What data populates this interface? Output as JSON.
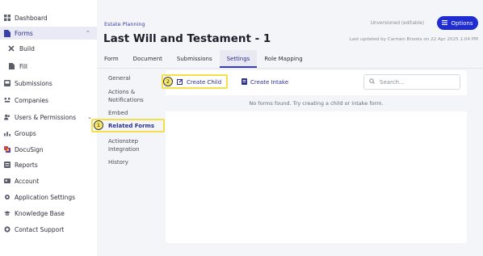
{
  "sidebar": {
    "items": [
      {
        "label": "Dashboard",
        "icon": "grid-icon"
      },
      {
        "label": "Forms",
        "icon": "document-icon",
        "expanded": true
      },
      {
        "label": "Build",
        "icon": "tools-icon"
      },
      {
        "label": "Fill",
        "icon": "file-icon"
      },
      {
        "label": "Submissions",
        "icon": "inbox-icon"
      },
      {
        "label": "Companies",
        "icon": "building-icon"
      },
      {
        "label": "Users & Permissions",
        "icon": "users-icon"
      },
      {
        "label": "Groups",
        "icon": "groups-icon"
      },
      {
        "label": "DocuSign",
        "icon": "docusign-icon"
      },
      {
        "label": "Reports",
        "icon": "report-icon"
      },
      {
        "label": "Account",
        "icon": "account-icon"
      },
      {
        "label": "Application Settings",
        "icon": "gear-icon"
      },
      {
        "label": "Knowledge Base",
        "icon": "graduation-cap-icon"
      },
      {
        "label": "Contact Support",
        "icon": "support-icon"
      }
    ]
  },
  "header": {
    "breadcrumb": "Estate Planning",
    "title": "Last Will and Testament - 1",
    "version": "Unversioned (editable)",
    "options_label": "Options",
    "updated": "Last updated by Carmen Brooks on 22 Apr 2025 1:04 PM"
  },
  "tabs": [
    {
      "label": "Form"
    },
    {
      "label": "Document"
    },
    {
      "label": "Submissions"
    },
    {
      "label": "Settings",
      "active": true
    },
    {
      "label": "Role Mapping"
    }
  ],
  "settings_nav": [
    {
      "label": "General"
    },
    {
      "label": "Actions & Notifications"
    },
    {
      "label": "Embed"
    },
    {
      "label": "Related Forms",
      "active": true
    },
    {
      "label": "Actionstep Integration"
    },
    {
      "label": "History"
    }
  ],
  "related_forms": {
    "create_child_label": "Create Child",
    "create_intake_label": "Create Intake",
    "search_placeholder": "Search...",
    "empty_message": "No forms found. Try creating a child or intake form."
  },
  "annotations": [
    {
      "number": "1",
      "target": "Related Forms"
    },
    {
      "number": "2",
      "target": "Create Child"
    }
  ],
  "colors": {
    "accent": "#1f2cd1",
    "link": "#2b2f8f",
    "highlight": "#f3e04a"
  }
}
